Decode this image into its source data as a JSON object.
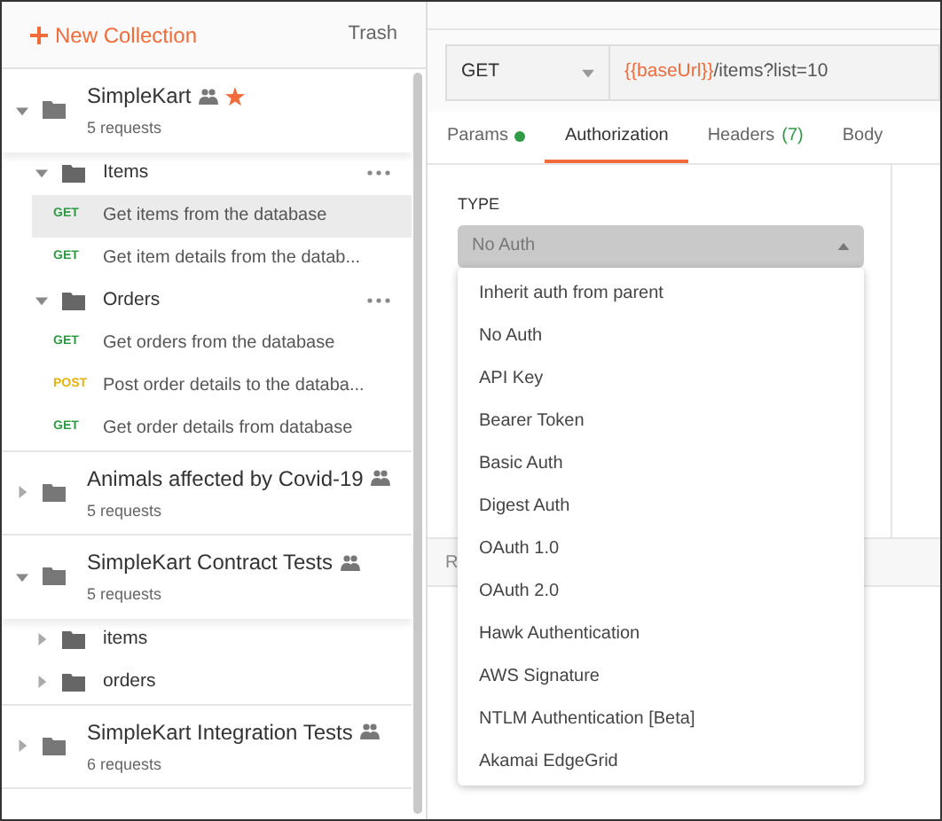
{
  "sidebar": {
    "new_collection": "New Collection",
    "trash": "Trash",
    "collections": [
      {
        "name": "SimpleKart",
        "subtitle": "5 requests",
        "shared": true,
        "starred": true,
        "expanded": true,
        "folders": [
          {
            "name": "Items",
            "expanded": true,
            "requests": [
              {
                "method": "GET",
                "name": "Get items from the database",
                "selected": true
              },
              {
                "method": "GET",
                "name": "Get item details from the datab...",
                "selected": false
              }
            ]
          },
          {
            "name": "Orders",
            "expanded": true,
            "requests": [
              {
                "method": "GET",
                "name": "Get orders from the database",
                "selected": false
              },
              {
                "method": "POST",
                "name": "Post order details to the databa...",
                "selected": false
              },
              {
                "method": "GET",
                "name": "Get order details from database",
                "selected": false
              }
            ]
          }
        ]
      },
      {
        "name": "Animals affected by Covid-19",
        "subtitle": "5 requests",
        "shared": true,
        "starred": false,
        "expanded": false
      },
      {
        "name": "SimpleKart Contract Tests",
        "subtitle": "5 requests",
        "shared": true,
        "starred": false,
        "expanded": true,
        "folders": [
          {
            "name": "items",
            "expanded": false
          },
          {
            "name": "orders",
            "expanded": false
          }
        ]
      },
      {
        "name": "SimpleKart Integration Tests",
        "subtitle": "6 requests",
        "shared": true,
        "starred": false,
        "expanded": false
      }
    ]
  },
  "request": {
    "method": "GET",
    "url_variable": "{{baseUrl}}",
    "url_path": "/items?list=10",
    "tabs": [
      {
        "label": "Params",
        "selected": false,
        "dot": true
      },
      {
        "label": "Authorization",
        "selected": true,
        "dot": false
      },
      {
        "label": "Headers",
        "count": "(7)",
        "selected": false,
        "dot": false
      },
      {
        "label": "Body",
        "selected": false,
        "dot": false
      }
    ],
    "type_label": "TYPE",
    "type_value": "No Auth",
    "response_label": "R",
    "auth_options": [
      "Inherit auth from parent",
      "No Auth",
      "API Key",
      "Bearer Token",
      "Basic Auth",
      "Digest Auth",
      "OAuth 1.0",
      "OAuth 2.0",
      "Hawk Authentication",
      "AWS Signature",
      "NTLM Authentication [Beta]",
      "Akamai EdgeGrid"
    ]
  }
}
